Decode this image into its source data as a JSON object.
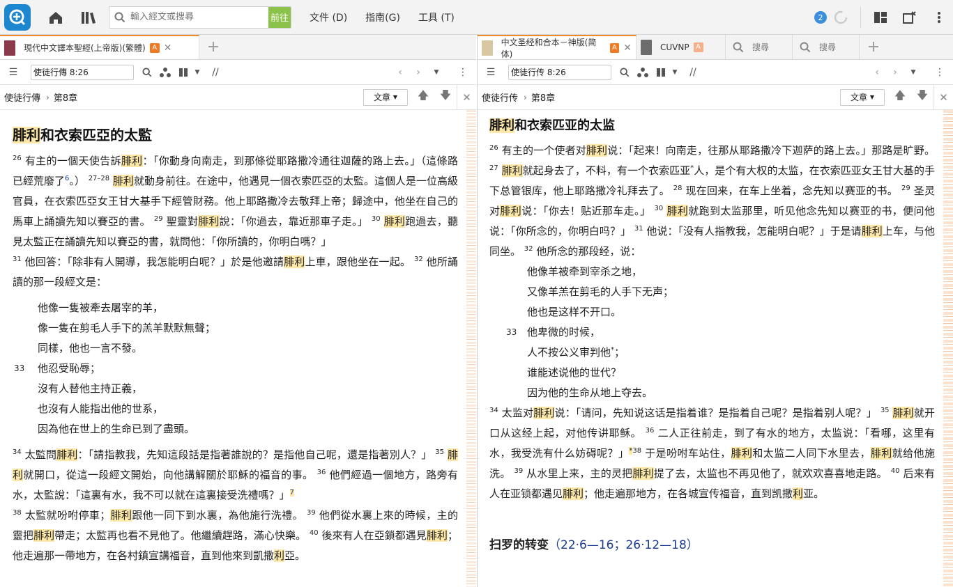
{
  "toolbar": {
    "search_placeholder": "輸入經文或搜尋",
    "go_label": "前往",
    "menu_file": "文件 (D)",
    "menu_guide": "指南(G)",
    "menu_tools": "工具 (T)",
    "notification_count": "2"
  },
  "left": {
    "tab_title": "現代中文譯本聖經(上帝版)(繁體)",
    "tab_badge": "A",
    "reference": "使徒行傳 8:26",
    "crumb_book": "使徒行傳",
    "crumb_chapter": "第8章",
    "type_label": "文章",
    "heading_pre": "",
    "heading_hl": "腓利",
    "heading_post": "和衣索匹亞的太監",
    "p1": {
      "v26": "26",
      "t1": "有主的一個天使告訴",
      "n1": "腓利",
      "t2": "：「你動身向南走，到那條從耶路撒冷通往迦薩的路上去。」（這條路已經荒廢了",
      "fn6": "6",
      "t3": "。）",
      "v2728": "27–28",
      "n2": "腓利",
      "t4": "就動身前往。在途中，他遇見一個衣索匹亞的太監。這個人是一位高級官員，在衣索匹亞女王甘大基手下經管財務。他上耶路撒冷去敬拜上帝；歸途中，他坐在自己的馬車上誦讀先知以賽亞的書。",
      "v29": "29",
      "t5": "聖靈對",
      "n3": "腓利",
      "t6": "說：「你過去，靠近那車子走。」",
      "v30": "30",
      "n4": "腓利",
      "t7": "跑過去，聽見太監正在誦讀先知以賽亞的書，就問他：「你所讀的，你明白嗎？」"
    },
    "p2": {
      "v31": "31",
      "t1": "他回答：「除非有人開導，我怎能明白呢？」於是他邀請",
      "n1": "腓利",
      "t2": "上車，跟他坐在一起。",
      "v32": "32",
      "t3": "他所誦讀的那一段經文是："
    },
    "poem": [
      {
        "v": "",
        "text": "他像一隻被牽去屠宰的羊，"
      },
      {
        "v": "",
        "text": "像一隻在剪毛人手下的羔羊默默無聲；"
      },
      {
        "v": "",
        "text": "同樣，他也一言不發。"
      },
      {
        "v": "33",
        "text": "他忍受恥辱；"
      },
      {
        "v": "",
        "text": "沒有人替他主持正義，"
      },
      {
        "v": "",
        "text": "也沒有人能指出他的世系，"
      },
      {
        "v": "",
        "text": "因為他在世上的生命已到了盡頭。"
      }
    ],
    "p3": {
      "v34": "34",
      "t1": "太監問",
      "n1": "腓利",
      "t2": "：「請指教我，先知這段話是指著誰說的？是指他自己呢，還是指著別人？」",
      "v35": "35",
      "n2": "腓利",
      "t3": "就開口，從這一段經文開始，向他講解關於耶穌的福音的事。",
      "v36": "36",
      "t4": "他們經過一個地方，路旁有水，太監說：「這裏有水，我不可以就在這裏接受洗禮嗎？」",
      "fn7": "7"
    },
    "p4": {
      "v38": "38",
      "t1": "太監就吩咐停車；",
      "n1": "腓利",
      "t2": "跟他一同下到水裏，為他施行洗禮。",
      "v39": "39",
      "t3": "他們從水裏上來的時候，主的靈把",
      "n2": "腓利",
      "t4": "帶走；太監再也看不見他了。他繼續趕路，滿心快樂。",
      "v40": "40",
      "t5": "後來有人在亞鎖都遇見",
      "n3": "腓利",
      "t6": "；他走遍那一帶地方，在各村鎮宣講福音，直到他來到凱撒",
      "n4": "利",
      "t7": "亞。"
    }
  },
  "right": {
    "tab_title": "中文圣经和合本－神版(简体)",
    "tab_badge": "A",
    "tab2_title": "CUVNP",
    "tab2_badge": "A",
    "tab3_title": "搜尋",
    "tab4_title": "搜尋",
    "reference": "使徒行传 8:26",
    "crumb_book": "使徒行传",
    "crumb_chapter": "第8章",
    "type_label": "文章",
    "heading_hl": "腓利",
    "heading_post": "和衣索匹亚的太监",
    "p1": {
      "v26": "26",
      "t1": "有主的一个使者对",
      "n1": "腓利",
      "t2": "说：「起来！向南走，往那从耶路撒冷下迦萨的路上去。」那路是旷野。",
      "v27": "27",
      "n2": "腓利",
      "t3": "就起身去了，不料，有一个衣索匹亚",
      "star1": "*",
      "t4": "人，是个有大权的太监，在衣索匹亚女王甘大基的手下总管银库，他上耶路撒冷礼拜去了。",
      "v28": "28",
      "t5": "现在回来，在车上坐着，念先知以赛亚的书。",
      "v29": "29",
      "t6": "圣灵对",
      "n3": "腓利",
      "t7": "说：「你去！贴近那车走。」",
      "v30": "30",
      "n4": "腓利",
      "t8": "就跑到太监那里，听见他念先知以赛亚的书，便问他说：「你所念的，你明白吗？」",
      "v31": "31",
      "t9": "他说：「没有人指教我，怎能明白呢？」于是请",
      "n5": "腓利",
      "t10": "上车，与他同坐。",
      "v32": "32",
      "t11": "他所念的那段经，说："
    },
    "poem": [
      {
        "v": "",
        "text": "他像羊被牵到宰杀之地，"
      },
      {
        "v": "",
        "text": "又像羊羔在剪毛的人手下无声；"
      },
      {
        "v": "",
        "text": "他也是这样不开口。"
      },
      {
        "v": "33",
        "text": "他卑微的时候，"
      },
      {
        "v": "",
        "text": "人不按公义审判他",
        "star": "*",
        "after": "；"
      },
      {
        "v": "",
        "text": "谁能述说他的世代？"
      },
      {
        "v": "",
        "text": "因为他的生命从地上夺去。"
      }
    ],
    "p2": {
      "v34": "34",
      "t1": "太监对",
      "n1": "腓利",
      "t2": "说：「请问，先知说这话是指着谁？是指着自己呢？是指着别人呢？」",
      "v35": "35",
      "n2": "腓利",
      "t3": "就开口从这经上起，对他传讲耶稣。",
      "v36": "36",
      "t4": "二人正往前走，到了有水的地方，太监说：「看哪，这里有水，我受洗有什么妨碍呢？」",
      "star2": "*",
      "v38": "38",
      "t5": "于是吩咐车站住，",
      "n3": "腓利",
      "t6": "和太监二人同下水里去，",
      "n4": "腓利",
      "t7": "就给他施洗。",
      "v39": "39",
      "t8": "从水里上来，主的灵把",
      "n5": "腓利",
      "t9": "提了去，太监也不再见他了，就欢欢喜喜地走路。",
      "v40": "40",
      "t10": "后来有人在亚锁都遇见",
      "n6": "腓利",
      "t11": "；他走遍那地方，在各城宣传福音，直到凯撒",
      "n7": "利",
      "t12": "亚。"
    },
    "next_heading": "扫罗的转变",
    "next_refs": "（22·6—16；26·12—18）"
  },
  "colors": {
    "accent_orange": "#f08a24",
    "highlight": "#fde8a7",
    "go_green": "#8bc34a",
    "logo_blue": "#1c86cf"
  }
}
